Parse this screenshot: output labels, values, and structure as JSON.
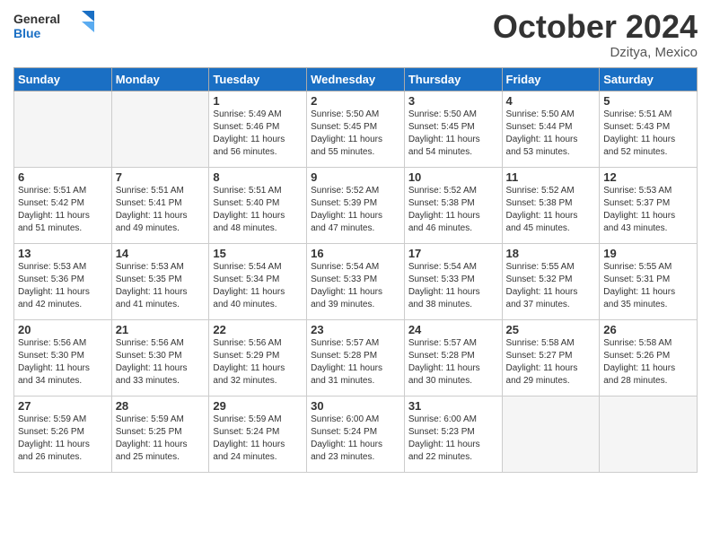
{
  "header": {
    "logo_line1": "General",
    "logo_line2": "Blue",
    "month": "October 2024",
    "location": "Dzitya, Mexico"
  },
  "weekdays": [
    "Sunday",
    "Monday",
    "Tuesday",
    "Wednesday",
    "Thursday",
    "Friday",
    "Saturday"
  ],
  "weeks": [
    [
      {
        "day": "",
        "empty": true
      },
      {
        "day": "",
        "empty": true
      },
      {
        "day": "1",
        "rise": "5:49 AM",
        "set": "5:46 PM",
        "daylight": "11 hours and 56 minutes."
      },
      {
        "day": "2",
        "rise": "5:50 AM",
        "set": "5:45 PM",
        "daylight": "11 hours and 55 minutes."
      },
      {
        "day": "3",
        "rise": "5:50 AM",
        "set": "5:45 PM",
        "daylight": "11 hours and 54 minutes."
      },
      {
        "day": "4",
        "rise": "5:50 AM",
        "set": "5:44 PM",
        "daylight": "11 hours and 53 minutes."
      },
      {
        "day": "5",
        "rise": "5:51 AM",
        "set": "5:43 PM",
        "daylight": "11 hours and 52 minutes."
      }
    ],
    [
      {
        "day": "6",
        "rise": "5:51 AM",
        "set": "5:42 PM",
        "daylight": "11 hours and 51 minutes."
      },
      {
        "day": "7",
        "rise": "5:51 AM",
        "set": "5:41 PM",
        "daylight": "11 hours and 49 minutes."
      },
      {
        "day": "8",
        "rise": "5:51 AM",
        "set": "5:40 PM",
        "daylight": "11 hours and 48 minutes."
      },
      {
        "day": "9",
        "rise": "5:52 AM",
        "set": "5:39 PM",
        "daylight": "11 hours and 47 minutes."
      },
      {
        "day": "10",
        "rise": "5:52 AM",
        "set": "5:38 PM",
        "daylight": "11 hours and 46 minutes."
      },
      {
        "day": "11",
        "rise": "5:52 AM",
        "set": "5:38 PM",
        "daylight": "11 hours and 45 minutes."
      },
      {
        "day": "12",
        "rise": "5:53 AM",
        "set": "5:37 PM",
        "daylight": "11 hours and 43 minutes."
      }
    ],
    [
      {
        "day": "13",
        "rise": "5:53 AM",
        "set": "5:36 PM",
        "daylight": "11 hours and 42 minutes."
      },
      {
        "day": "14",
        "rise": "5:53 AM",
        "set": "5:35 PM",
        "daylight": "11 hours and 41 minutes."
      },
      {
        "day": "15",
        "rise": "5:54 AM",
        "set": "5:34 PM",
        "daylight": "11 hours and 40 minutes."
      },
      {
        "day": "16",
        "rise": "5:54 AM",
        "set": "5:33 PM",
        "daylight": "11 hours and 39 minutes."
      },
      {
        "day": "17",
        "rise": "5:54 AM",
        "set": "5:33 PM",
        "daylight": "11 hours and 38 minutes."
      },
      {
        "day": "18",
        "rise": "5:55 AM",
        "set": "5:32 PM",
        "daylight": "11 hours and 37 minutes."
      },
      {
        "day": "19",
        "rise": "5:55 AM",
        "set": "5:31 PM",
        "daylight": "11 hours and 35 minutes."
      }
    ],
    [
      {
        "day": "20",
        "rise": "5:56 AM",
        "set": "5:30 PM",
        "daylight": "11 hours and 34 minutes."
      },
      {
        "day": "21",
        "rise": "5:56 AM",
        "set": "5:30 PM",
        "daylight": "11 hours and 33 minutes."
      },
      {
        "day": "22",
        "rise": "5:56 AM",
        "set": "5:29 PM",
        "daylight": "11 hours and 32 minutes."
      },
      {
        "day": "23",
        "rise": "5:57 AM",
        "set": "5:28 PM",
        "daylight": "11 hours and 31 minutes."
      },
      {
        "day": "24",
        "rise": "5:57 AM",
        "set": "5:28 PM",
        "daylight": "11 hours and 30 minutes."
      },
      {
        "day": "25",
        "rise": "5:58 AM",
        "set": "5:27 PM",
        "daylight": "11 hours and 29 minutes."
      },
      {
        "day": "26",
        "rise": "5:58 AM",
        "set": "5:26 PM",
        "daylight": "11 hours and 28 minutes."
      }
    ],
    [
      {
        "day": "27",
        "rise": "5:59 AM",
        "set": "5:26 PM",
        "daylight": "11 hours and 26 minutes."
      },
      {
        "day": "28",
        "rise": "5:59 AM",
        "set": "5:25 PM",
        "daylight": "11 hours and 25 minutes."
      },
      {
        "day": "29",
        "rise": "5:59 AM",
        "set": "5:24 PM",
        "daylight": "11 hours and 24 minutes."
      },
      {
        "day": "30",
        "rise": "6:00 AM",
        "set": "5:24 PM",
        "daylight": "11 hours and 23 minutes."
      },
      {
        "day": "31",
        "rise": "6:00 AM",
        "set": "5:23 PM",
        "daylight": "11 hours and 22 minutes."
      },
      {
        "day": "",
        "empty": true
      },
      {
        "day": "",
        "empty": true
      }
    ]
  ],
  "labels": {
    "sunrise": "Sunrise:",
    "sunset": "Sunset:",
    "daylight": "Daylight:"
  }
}
